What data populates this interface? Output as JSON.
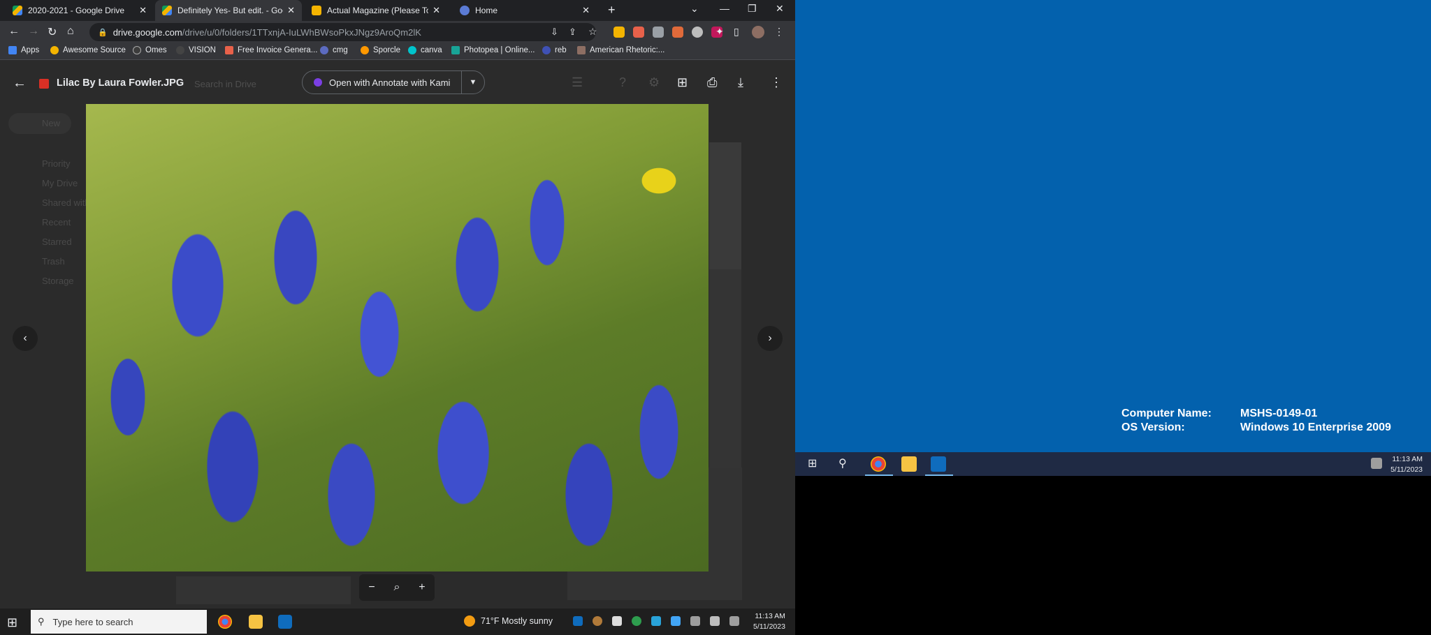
{
  "browser": {
    "tabs": [
      {
        "title": "2020-2021 - Google Drive",
        "active": false
      },
      {
        "title": "Definitely Yes- But edit. - Google",
        "active": true
      },
      {
        "title": "Actual Magazine (Please Touch)",
        "active": false
      },
      {
        "title": "Home",
        "active": false
      }
    ],
    "url": {
      "host": "drive.google.com",
      "path": "/drive/u/0/folders/1TTxnjA-IuLWhBWsoPkxJNgz9AroQm2lK"
    },
    "bookmarks": [
      "Apps",
      "Awesome Source",
      "Omes",
      "VISION",
      "Free Invoice Genera...",
      "cmg",
      "Sporcle",
      "canva",
      "Photopea | Online...",
      "reb",
      "American Rhetoric:..."
    ]
  },
  "drive": {
    "filename": "Lilac By Laura Fowler.JPG",
    "search_placeholder": "Search in Drive",
    "open_with_label": "Open with Annotate with Kami",
    "background_sidebar": [
      "New",
      "Priority",
      "My Drive",
      "Shared with me",
      "Recent",
      "Starred",
      "Trash",
      "Storage"
    ]
  },
  "taskbar_left": {
    "search_placeholder": "Type here to search",
    "weather": "71°F  Mostly sunny",
    "time": "11:13 AM",
    "date": "5/11/2023"
  },
  "desktop": {
    "computer_name_label": "Computer Name:",
    "computer_name_value": "MSHS-0149-01",
    "os_version_label": "OS Version:",
    "os_version_value": "Windows 10 Enterprise 2009",
    "time": "11:13 AM",
    "date": "5/11/2023"
  }
}
